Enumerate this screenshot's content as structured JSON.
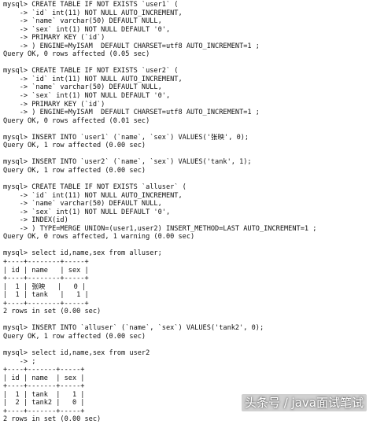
{
  "terminal": {
    "lines": [
      "mysql> CREATE TABLE IF NOT EXISTS `user1` (",
      "    -> `id` int(11) NOT NULL AUTO_INCREMENT,",
      "    -> `name` varchar(50) DEFAULT NULL,",
      "    -> `sex` int(1) NOT NULL DEFAULT '0',",
      "    -> PRIMARY KEY (`id`)",
      "    -> ) ENGINE=MyISAM  DEFAULT CHARSET=utf8 AUTO_INCREMENT=1 ;",
      "Query OK, 0 rows affected (0.05 sec)",
      "",
      "mysql> CREATE TABLE IF NOT EXISTS `user2` (",
      "    -> `id` int(11) NOT NULL AUTO_INCREMENT,",
      "    -> `name` varchar(50) DEFAULT NULL,",
      "    -> `sex` int(1) NOT NULL DEFAULT '0',",
      "    -> PRIMARY KEY (`id`)",
      "    -> ) ENGINE=MyISAM  DEFAULT CHARSET=utf8 AUTO_INCREMENT=1 ;",
      "Query OK, 0 rows affected (0.01 sec)",
      "",
      "mysql> INSERT INTO `user1` (`name`, `sex`) VALUES('张映', 0);",
      "Query OK, 1 row affected (0.00 sec)",
      "",
      "mysql> INSERT INTO `user2` (`name`, `sex`) VALUES('tank', 1);",
      "Query OK, 1 row affected (0.00 sec)",
      "",
      "mysql> CREATE TABLE IF NOT EXISTS `alluser` (",
      "    -> `id` int(11) NOT NULL AUTO_INCREMENT,",
      "    -> `name` varchar(50) DEFAULT NULL,",
      "    -> `sex` int(1) NOT NULL DEFAULT '0',",
      "    -> INDEX(id)",
      "    -> ) TYPE=MERGE UNION=(user1,user2) INSERT_METHOD=LAST AUTO_INCREMENT=1 ;",
      "Query OK, 0 rows affected, 1 warning (0.00 sec)",
      "",
      "mysql> select id,name,sex from alluser;",
      "+----+--------+-----+",
      "| id | name   | sex |",
      "+----+--------+-----+",
      "|  1 | 张映   |   0 |",
      "|  1 | tank   |   1 |",
      "+----+--------+-----+",
      "2 rows in set (0.00 sec)",
      "",
      "mysql> INSERT INTO `alluser` (`name`, `sex`) VALUES('tank2', 0);",
      "Query OK, 1 row affected (0.00 sec)",
      "",
      "mysql> select id,name,sex from user2",
      "    -> ;",
      "+----+-------+-----+",
      "| id | name  | sex |",
      "+----+-------+-----+",
      "|  1 | tank  |   1 |",
      "|  2 | tank2 |   0 |",
      "+----+-------+-----+",
      "2 rows in set (0.00 sec)"
    ]
  },
  "watermark": {
    "text": "头条号 / java面试笔试"
  }
}
